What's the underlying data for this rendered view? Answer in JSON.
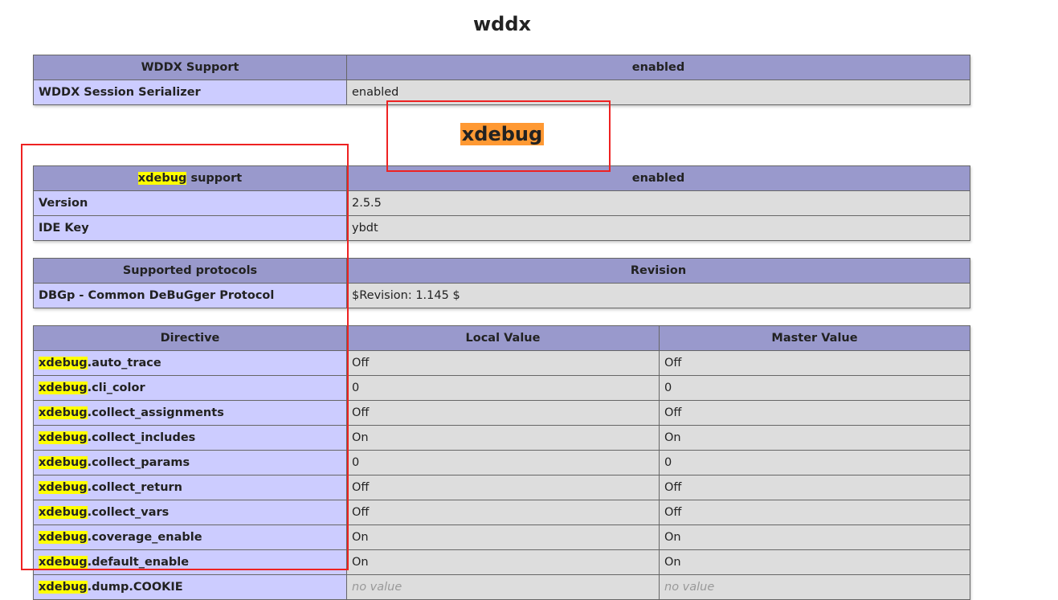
{
  "wddx": {
    "title": "wddx",
    "header": [
      "WDDX Support",
      "enabled"
    ],
    "rows": [
      [
        "WDDX Session Serializer",
        "enabled"
      ]
    ]
  },
  "xdebug": {
    "title": "xdebug",
    "highlight_color": "#ff9933",
    "support": {
      "header_hl": "xdebug",
      "header_rest": " support",
      "header_value": "enabled",
      "rows": [
        [
          "Version",
          "2.5.5"
        ],
        [
          "IDE Key",
          "ybdt"
        ]
      ]
    },
    "protocols": {
      "header": [
        "Supported protocols",
        "Revision"
      ],
      "rows": [
        [
          "DBGp - Common DeBuGger Protocol",
          "$Revision: 1.145 $"
        ]
      ]
    },
    "directives": {
      "header": [
        "Directive",
        "Local Value",
        "Master Value"
      ],
      "prefix": "xdebug",
      "rows": [
        [
          ".auto_trace",
          "Off",
          "Off"
        ],
        [
          ".cli_color",
          "0",
          "0"
        ],
        [
          ".collect_assignments",
          "Off",
          "Off"
        ],
        [
          ".collect_includes",
          "On",
          "On"
        ],
        [
          ".collect_params",
          "0",
          "0"
        ],
        [
          ".collect_return",
          "Off",
          "Off"
        ],
        [
          ".collect_vars",
          "Off",
          "Off"
        ],
        [
          ".coverage_enable",
          "On",
          "On"
        ],
        [
          ".default_enable",
          "On",
          "On"
        ],
        [
          ".dump.COOKIE",
          "no value",
          "no value"
        ]
      ]
    }
  }
}
